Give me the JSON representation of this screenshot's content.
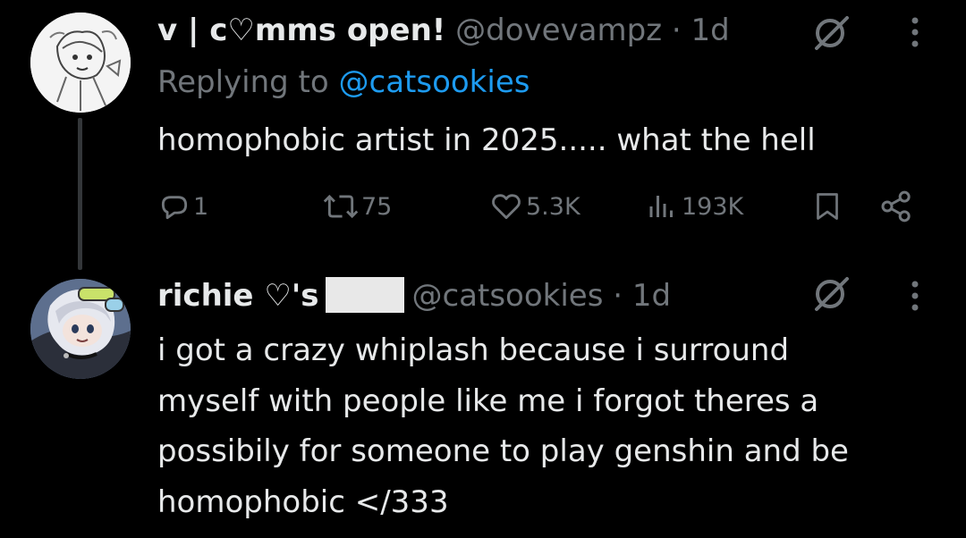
{
  "reply_tweet": {
    "display_name": "v | c♡mms open!",
    "handle": "@dovevampz",
    "separator": "·",
    "time": "1d",
    "replying_to_prefix": "Replying to",
    "replying_to_mention": "@catsookies",
    "text": "homophobic artist in 2025..... what the hell",
    "actions": {
      "replies": "1",
      "reposts": "75",
      "likes": "5.3K",
      "views": "193K"
    }
  },
  "main_tweet": {
    "display_name": "richie ♡'s",
    "handle": "@catsookies",
    "separator": "·",
    "time": "1d",
    "text_lines": [
      "i got a crazy whiplash because i surround",
      "myself with people like me i forgot theres a",
      "possibily for someone to play genshin and be",
      "homophobic </333"
    ]
  },
  "colors": {
    "background": "#000000",
    "primary_text": "#e7e9ea",
    "secondary_text": "#71767b",
    "link": "#1d9bf0",
    "thread_line": "#333639"
  },
  "icons": [
    "reply-icon",
    "repost-icon",
    "like-icon",
    "views-icon",
    "bookmark-icon",
    "share-icon",
    "grok-icon",
    "more-icon"
  ]
}
